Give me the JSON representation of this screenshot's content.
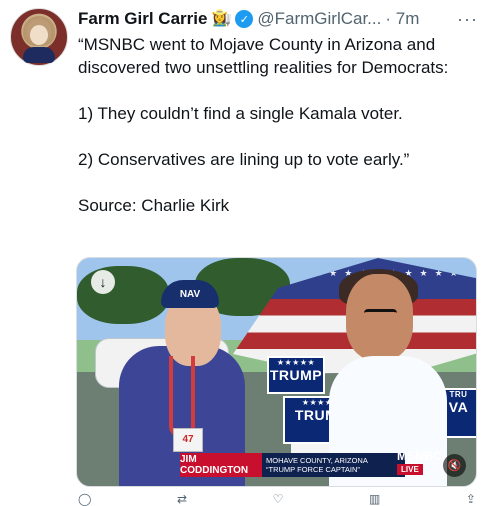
{
  "tweet": {
    "name": "Farm Girl Carrie",
    "emoji": "👩‍🌾",
    "handle": "@FarmGirlCar...",
    "time": "· 7m",
    "more": "···",
    "text": "“MSNBC went to Mojave County in Arizona and discovered two unsettling realities for Democrats:\n\n1) They couldn’t find a single Kamala voter.\n\n2) Conservatives are lining up to vote early.”\n\nSource: Charlie Kirk"
  },
  "media": {
    "download_icon": "download-icon",
    "cap_text": "NAV",
    "badge_text": "47",
    "sign1": {
      "small": "★★★★★",
      "big": "TRUMP"
    },
    "sign2": {
      "small": "★★★★★",
      "big": "TRUMP"
    },
    "sign3": {
      "small": "TRU",
      "big": "VA"
    },
    "chyron_name": "JIM CODDINGTON",
    "chyron_caption": "MOHAVE COUNTY, ARIZONA\n“TRUMP FORCE CAPTAIN”",
    "network_logo": "MSNBC",
    "live_label": "LIVE",
    "mute_icon": "mute-icon"
  }
}
